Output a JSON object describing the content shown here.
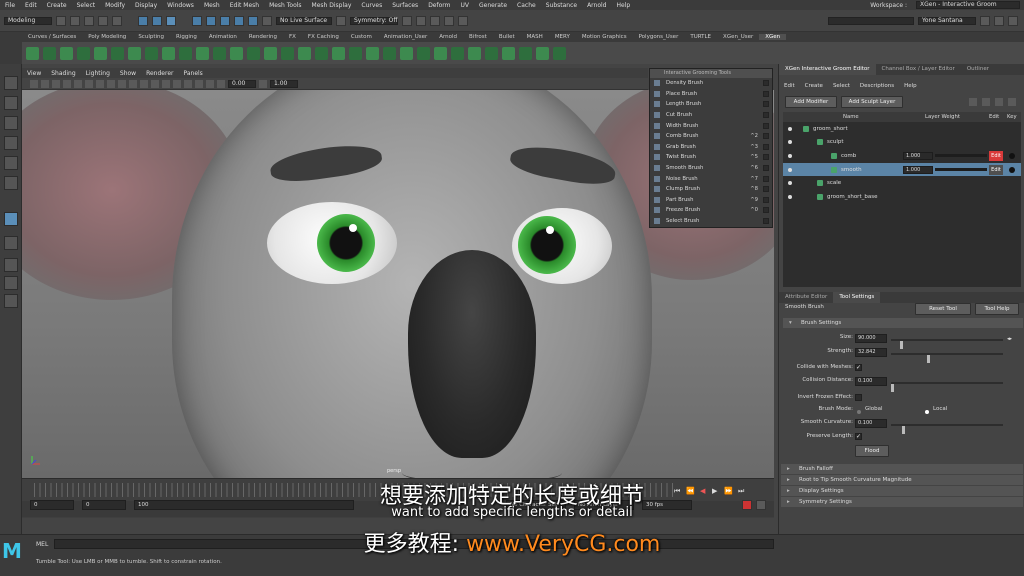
{
  "menubar": {
    "items": [
      "File",
      "Edit",
      "Create",
      "Select",
      "Modify",
      "Display",
      "Windows",
      "Mesh",
      "Edit Mesh",
      "Mesh Tools",
      "Mesh Display",
      "Curves",
      "Surfaces",
      "Deform",
      "UV",
      "Generate",
      "Cache",
      "Substance",
      "Arnold",
      "Help"
    ],
    "workspace_label": "Workspace :",
    "workspace_value": "XGen - Interactive Groom"
  },
  "statusline": {
    "mode": "Modeling",
    "live_surface": "No Live Surface",
    "symmetry": "Symmetry: Off",
    "user": "Yone Santana"
  },
  "shelf": {
    "tabs": [
      "Curves / Surfaces",
      "Poly Modeling",
      "Sculpting",
      "Rigging",
      "Animation",
      "Rendering",
      "FX",
      "FX Caching",
      "Custom",
      "Animation_User",
      "Arnold",
      "Bifrost",
      "Bullet",
      "MASH",
      "MERY",
      "Motion Graphics",
      "Polygons_User",
      "TURTLE",
      "XGen_User",
      "XGen"
    ],
    "active": "XGen"
  },
  "viewport": {
    "menu": [
      "View",
      "Shading",
      "Lighting",
      "Show",
      "Renderer",
      "Panels"
    ],
    "field_a": "0.00",
    "field_b": "1.00",
    "camera_label": "persp"
  },
  "groom_tools": {
    "title": "Interactive Grooming Tools",
    "brushes": [
      {
        "label": "Density Brush",
        "shortcut": ""
      },
      {
        "label": "Place Brush",
        "shortcut": ""
      },
      {
        "label": "Length Brush",
        "shortcut": ""
      },
      {
        "label": "Cut Brush",
        "shortcut": ""
      },
      {
        "label": "Width Brush",
        "shortcut": ""
      },
      {
        "label": "Comb Brush",
        "shortcut": "^2"
      },
      {
        "label": "Grab Brush",
        "shortcut": "^3"
      },
      {
        "label": "Twist Brush",
        "shortcut": "^5"
      },
      {
        "label": "Smooth Brush",
        "shortcut": "^6"
      },
      {
        "label": "Noise Brush",
        "shortcut": "^7"
      },
      {
        "label": "Clump Brush",
        "shortcut": "^8"
      },
      {
        "label": "Part Brush",
        "shortcut": "^9"
      },
      {
        "label": "Freeze Brush",
        "shortcut": "^0"
      },
      {
        "label": "Select Brush",
        "shortcut": ""
      }
    ]
  },
  "editor": {
    "tabs": [
      "XGen Interactive Groom Editor",
      "Channel Box / Layer Editor",
      "Outliner"
    ],
    "menu": [
      "Edit",
      "Create",
      "Select",
      "Descriptions",
      "Help"
    ],
    "add_modifier": "Add Modifier",
    "add_sculpt_layer": "Add Sculpt Layer",
    "columns": {
      "name": "Name",
      "layer_weight": "Layer Weight",
      "edit": "Edit",
      "key": "Key"
    },
    "rows": [
      {
        "name": "groom_short",
        "indent": 0,
        "weight": "",
        "selected": false,
        "edit": ""
      },
      {
        "name": "sculpt",
        "indent": 1,
        "weight": "",
        "selected": false,
        "edit": ""
      },
      {
        "name": "comb",
        "indent": 2,
        "weight": "1.000",
        "selected": false,
        "edit": "Edit"
      },
      {
        "name": "smooth",
        "indent": 2,
        "weight": "1.000",
        "selected": true,
        "edit": "Edit"
      },
      {
        "name": "scale",
        "indent": 1,
        "weight": "",
        "selected": false,
        "edit": ""
      },
      {
        "name": "groom_short_base",
        "indent": 1,
        "weight": "",
        "selected": false,
        "edit": ""
      }
    ]
  },
  "attr": {
    "tabs": [
      "Attribute Editor",
      "Tool Settings"
    ],
    "tool_name": "Smooth Brush",
    "reset_tool": "Reset Tool",
    "tool_help": "Tool Help",
    "section_brush": "Brush Settings",
    "size_label": "Size:",
    "size_value": "90.000",
    "size_level": 0.08,
    "strength_label": "Strength:",
    "strength_value": "32.842",
    "strength_level": 0.33,
    "collide_label": "Collide with Meshes:",
    "collision_label": "Collision Distance:",
    "collision_value": "0.100",
    "collision_level": 0.0,
    "invert_label": "Invert Frozen Effect:",
    "mode_label": "Brush Mode:",
    "mode_global": "Global",
    "mode_local": "Local",
    "curvature_label": "Smooth Curvature:",
    "curvature_value": "0.100",
    "curvature_level": 0.1,
    "preserve_label": "Preserve Length:",
    "flood": "Flood",
    "sections": [
      "Brush Falloff",
      "Root to Tip Smooth Curvature Magnitude",
      "Display Settings",
      "Symmetry Settings"
    ]
  },
  "timeline": {
    "start": "0",
    "range_start": "0",
    "range_end": "100",
    "no_char_set": "No Character Set",
    "no_anim_layer": "No Anim Layer",
    "fps": "30 fps"
  },
  "cmdline": {
    "mel": "MEL",
    "help": "Tumble Tool: Use LMB or MMB to tumble. Shift to constrain rotation."
  },
  "subtitles": {
    "cn": "想要添加特定的长度或细节",
    "en": "want to add specific lengths or detail",
    "wm_prefix": "更多教程:",
    "wm_url": "www.VeryCG.com"
  },
  "colors": {
    "selection": "#5b84a6",
    "edit_red": "#d93a3a",
    "iris_green": "#3fae3f",
    "watermark_orange": "#ff8a1e",
    "maya_logo": "#3ec6e8"
  }
}
